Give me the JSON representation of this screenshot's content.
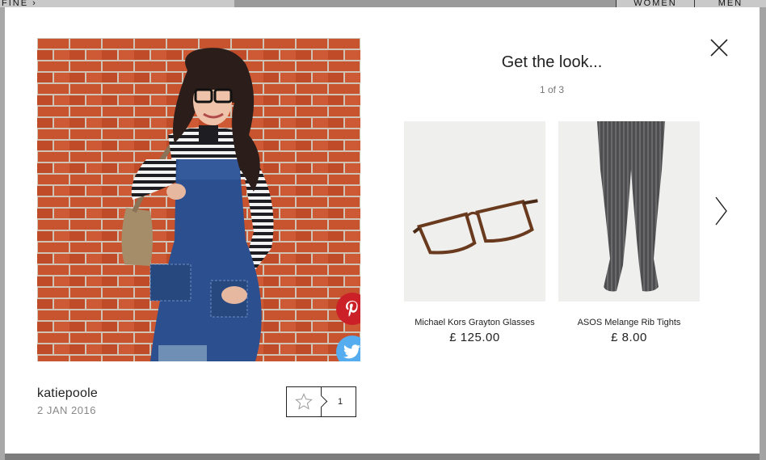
{
  "background_nav": {
    "left_label": "FINE ›",
    "women_label": "WOMEN",
    "men_label": "MEN"
  },
  "modal": {
    "close_icon": "close-icon",
    "photo": {
      "alt": "katiepoole outfit photo",
      "share": {
        "pinterest_icon": "pinterest-icon",
        "twitter_icon": "twitter-icon"
      }
    },
    "user": {
      "name": "katiepoole",
      "date": "2 JAN 2016"
    },
    "favourite": {
      "icon": "star-icon",
      "count": "1"
    },
    "look": {
      "title": "Get the look...",
      "pager": "1 of 3",
      "products": [
        {
          "name": "Michael Kors Grayton Glasses",
          "price": "£ 125.00"
        },
        {
          "name": "ASOS Melange Rib Tights",
          "price": "£ 8.00"
        }
      ],
      "next_icon": "chevron-right-icon"
    }
  }
}
